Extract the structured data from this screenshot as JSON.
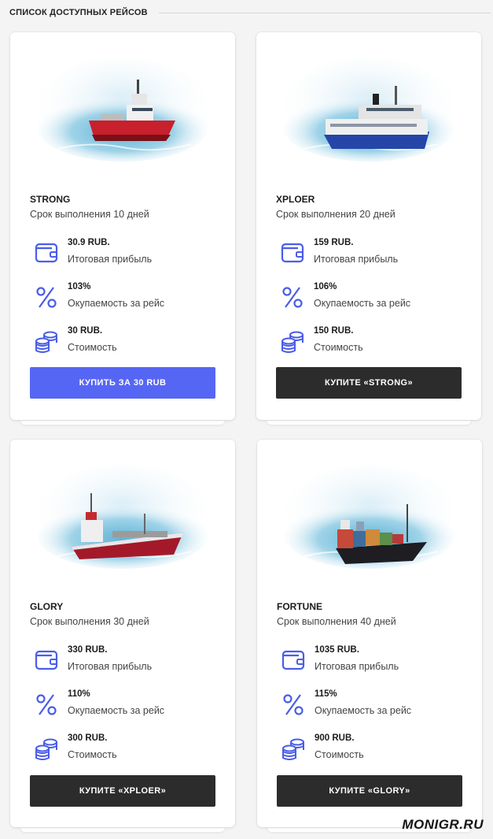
{
  "section": {
    "title": "СПИСОК ДОСТУПНЫХ РЕЙСОВ"
  },
  "icons": {
    "wallet": "wallet-icon",
    "percent": "percent-icon",
    "coins": "coins-icon"
  },
  "colors": {
    "primary_button": "#5666f4",
    "dark_button": "#2c2c2c",
    "icon_accent": "#4a5de8"
  },
  "cards": [
    {
      "name": "STRONG",
      "duration": "Срок выполнения 10 дней",
      "profit_value": "30.9 RUB.",
      "profit_label": "Итоговая прибыль",
      "payback_value": "103%",
      "payback_label": "Окупаемость за рейс",
      "cost_value": "30 RUB.",
      "cost_label": "Стоимость",
      "button": "КУПИТЬ ЗА 30 RUB",
      "button_style": "primary"
    },
    {
      "name": "XPLOER",
      "duration": "Срок выполнения 20 дней",
      "profit_value": "159 RUB.",
      "profit_label": "Итоговая прибыль",
      "payback_value": "106%",
      "payback_label": "Окупаемость за рейс",
      "cost_value": "150 RUB.",
      "cost_label": "Стоимость",
      "button": "КУПИТЕ «STRONG»",
      "button_style": "dark"
    },
    {
      "name": "GLORY",
      "duration": "Срок выполнения 30 дней",
      "profit_value": "330 RUB.",
      "profit_label": "Итоговая прибыль",
      "payback_value": "110%",
      "payback_label": "Окупаемость за рейс",
      "cost_value": "300 RUB.",
      "cost_label": "Стоимость",
      "button": "КУПИТЕ «XPLOER»",
      "button_style": "dark"
    },
    {
      "name": "FORTUNE",
      "duration": "Срок выполнения 40 дней",
      "profit_value": "1035 RUB.",
      "profit_label": "Итоговая прибыль",
      "payback_value": "115%",
      "payback_label": "Окупаемость за рейс",
      "cost_value": "900 RUB.",
      "cost_label": "Стоимость",
      "button": "КУПИТЕ «GLORY»",
      "button_style": "dark"
    }
  ],
  "watermark": "MONIGR.RU"
}
